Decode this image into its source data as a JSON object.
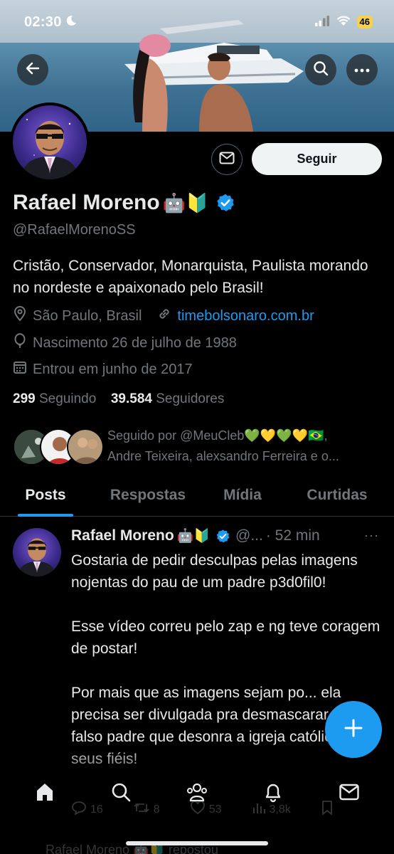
{
  "status_bar": {
    "time": "02:30",
    "battery": "46"
  },
  "profile": {
    "name": "Rafael Moreno",
    "name_emojis": "🤖🔰",
    "handle": "@RafaelMorenoSS",
    "bio": "Cristão, Conservador, Monarquista, Paulista morando no nordeste e apaixonado pelo Brasil!",
    "location": "São Paulo, Brasil",
    "website": "timebolsonaro.com.br",
    "birth": "Nascimento 26 de julho de 1988",
    "joined": "Entrou em junho de 2017",
    "following_count": "299",
    "following_label": "Seguindo",
    "followers_count": "39.584",
    "followers_label": "Seguidores",
    "followed_by_line1": "Seguido por @MeuCleb💚💛💚💛🇧🇷,",
    "followed_by_line2": "Andre Teixeira, alexsandro Ferreira e o..."
  },
  "actions": {
    "follow_label": "Seguir"
  },
  "tabs": [
    {
      "label": "Posts",
      "active": true
    },
    {
      "label": "Respostas",
      "active": false
    },
    {
      "label": "Mídia",
      "active": false
    },
    {
      "label": "Curtidas",
      "active": false
    }
  ],
  "post": {
    "author": "Rafael Moreno",
    "author_emojis": "🤖🔰",
    "handle_short": "@...",
    "time": "· 52 min",
    "more": "···",
    "paragraph1": "Gostaria de pedir desculpas pelas imagens nojentas do pau de um padre p3d0fil0!",
    "paragraph2": "Esse vídeo correu pelo zap e ng teve coragem de postar!",
    "paragraph3": "Por mais que as imagens sejam po... ela precisa ser divulgada pra desmascarar esse falso padre que desonra a igreja católica e seus fiéis!",
    "replies": "16",
    "reposts": "8",
    "likes": "53",
    "views": "3,8k"
  },
  "next_item": {
    "text": "Rafael Moreno 🤖🔰 repostou"
  },
  "colors": {
    "accent": "#1d9bf0",
    "background": "#000000",
    "text": "#e7e9ea",
    "muted": "#71767b",
    "verified": "#1d9bf0"
  }
}
